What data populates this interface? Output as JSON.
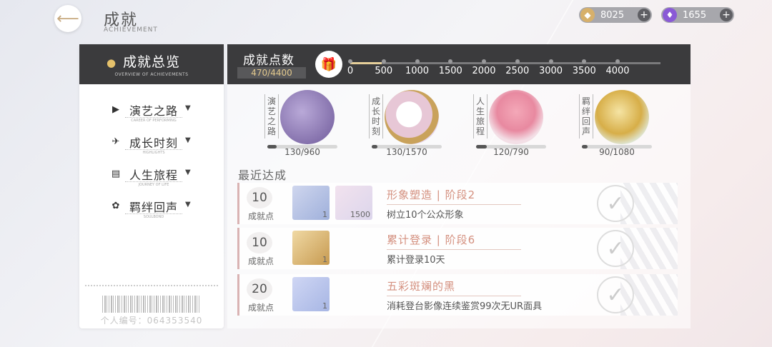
{
  "header": {
    "title": "成就",
    "subtitle": "ACHIEVEMENT"
  },
  "currencies": [
    {
      "icon": "gold-coin-icon",
      "value": "8025",
      "color": "#d7b06a"
    },
    {
      "icon": "purple-crystal-icon",
      "value": "1655",
      "color": "#8a5ad6"
    }
  ],
  "sidebar": {
    "header_title": "成就总览",
    "header_sub": "OVERVIEW OF ACHIEVEMENTS",
    "items": [
      {
        "label": "演艺之路",
        "sub": "CAREER OF PERFORMING",
        "icon": "video-camera-icon"
      },
      {
        "label": "成长时刻",
        "sub": "HIGHLIGHTS",
        "icon": "airplane-icon"
      },
      {
        "label": "人生旅程",
        "sub": "JOURNEY OF LIFE",
        "icon": "document-icon"
      },
      {
        "label": "羁绊回声",
        "sub": "SOULBOND",
        "icon": "clover-icon"
      }
    ],
    "player_id": "个人编号：064353540"
  },
  "points": {
    "label": "成就点数",
    "value": "470/4400",
    "current": 470,
    "max": 4400,
    "milestones": [
      "0",
      "500",
      "1000",
      "1500",
      "2000",
      "2500",
      "3000",
      "3500",
      "4000"
    ]
  },
  "categories": [
    {
      "label": "演艺之路",
      "progress": "130/960",
      "fraction": 0.135,
      "icon": "film-clapper-icon"
    },
    {
      "label": "成长时刻",
      "progress": "130/1570",
      "fraction": 0.083,
      "icon": "pocket-watch-icon"
    },
    {
      "label": "人生旅程",
      "progress": "120/790",
      "fraction": 0.152,
      "icon": "hot-air-balloon-icon"
    },
    {
      "label": "羁绊回声",
      "progress": "90/1080",
      "fraction": 0.083,
      "icon": "gramophone-icon"
    }
  ],
  "recent": {
    "title": "最近达成",
    "points_unit": "成就点",
    "items": [
      {
        "points": "10",
        "name": "形象塑造 | 阶段2",
        "desc": "树立10个公众形象",
        "rewards": [
          {
            "icon": "brush-item-icon",
            "count": "1"
          },
          {
            "icon": "magic-wand-item-icon",
            "count": "1500"
          }
        ]
      },
      {
        "points": "10",
        "name": "累计登录 | 阶段6",
        "desc": "累计登录10天",
        "rewards": [
          {
            "icon": "ticket-item-icon",
            "count": "1"
          }
        ]
      },
      {
        "points": "20",
        "name": "五彩斑斓的黑",
        "desc": "消耗登台影像连续鉴赏99次无UR面具",
        "rewards": [
          {
            "icon": "purple-ring-item-icon",
            "count": "1"
          }
        ]
      }
    ]
  }
}
